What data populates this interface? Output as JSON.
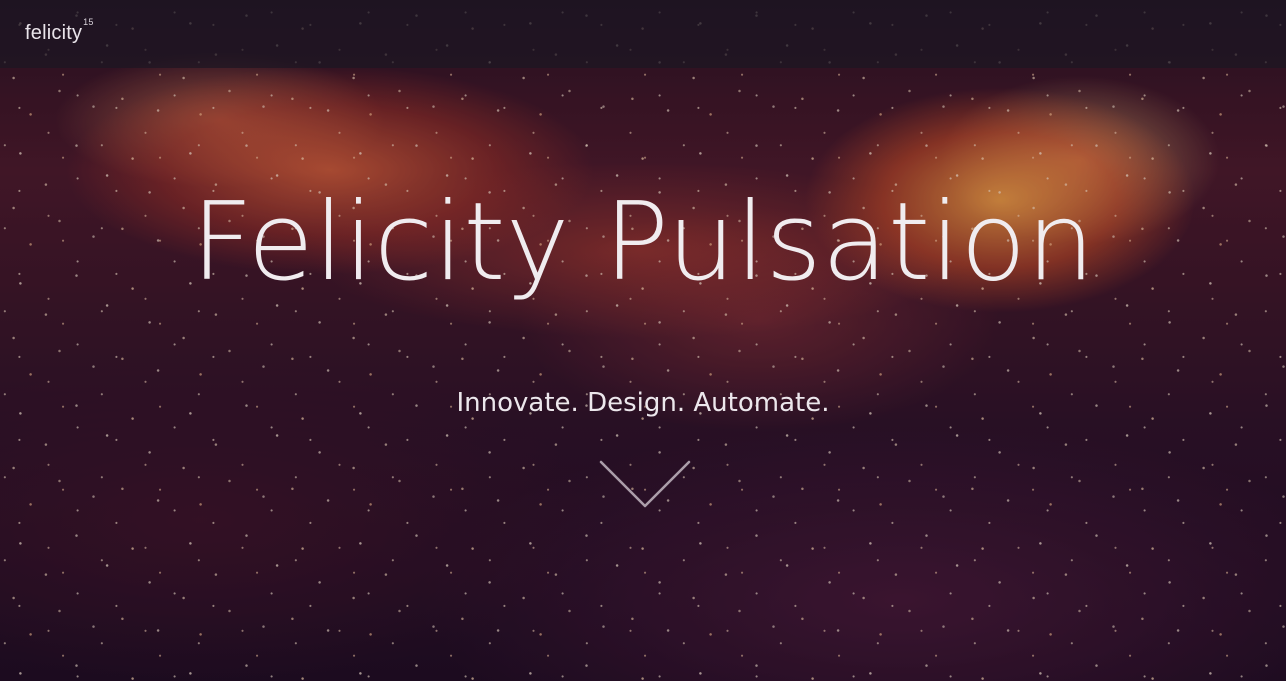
{
  "navbar": {
    "logo_text": "felicity",
    "logo_superscript": "15"
  },
  "hero": {
    "title": "Felicity Pulsation",
    "subtitle": "Innovate. Design. Automate.",
    "scroll_icon": "chevron-down-icon"
  },
  "colors": {
    "navbar_bg": "#1c1622",
    "text": "#f0ecef",
    "nebula_orange": "#f07a3c",
    "background_dark": "#1e0f1c"
  }
}
